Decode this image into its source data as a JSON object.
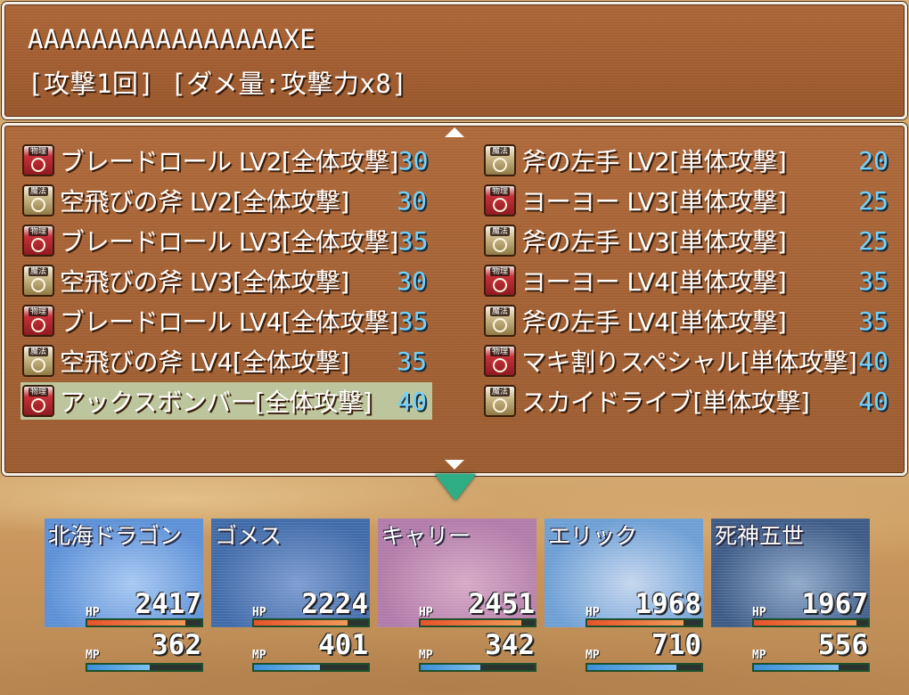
{
  "help": {
    "line1": "AAAAAAAAAAAAAAAAXE",
    "line2": "[攻撃1回] [ダメ量:攻撃力x8]"
  },
  "skills": [
    {
      "icon": "物理",
      "type": "phys",
      "name": "ブレードロール  LV2[全体攻撃]",
      "cost": "30"
    },
    {
      "icon": "魔法",
      "type": "magic",
      "name": "斧の左手  LV2[単体攻撃]",
      "cost": "20"
    },
    {
      "icon": "魔法",
      "type": "magic",
      "name": "空飛びの斧  LV2[全体攻撃]",
      "cost": "30"
    },
    {
      "icon": "物理",
      "type": "phys",
      "name": "ヨーヨー  LV3[単体攻撃]",
      "cost": "25"
    },
    {
      "icon": "物理",
      "type": "phys",
      "name": "ブレードロール  LV3[全体攻撃]",
      "cost": "35"
    },
    {
      "icon": "魔法",
      "type": "magic",
      "name": "斧の左手  LV3[単体攻撃]",
      "cost": "25"
    },
    {
      "icon": "魔法",
      "type": "magic",
      "name": "空飛びの斧  LV3[全体攻撃]",
      "cost": "30"
    },
    {
      "icon": "物理",
      "type": "phys",
      "name": "ヨーヨー  LV4[単体攻撃]",
      "cost": "35"
    },
    {
      "icon": "物理",
      "type": "phys",
      "name": "ブレードロール  LV4[全体攻撃]",
      "cost": "35"
    },
    {
      "icon": "魔法",
      "type": "magic",
      "name": "斧の左手  LV4[単体攻撃]",
      "cost": "35"
    },
    {
      "icon": "魔法",
      "type": "magic",
      "name": "空飛びの斧  LV4[全体攻撃]",
      "cost": "35"
    },
    {
      "icon": "物理",
      "type": "phys",
      "name": "マキ割りスペシャル[単体攻撃]",
      "cost": "40"
    },
    {
      "icon": "物理",
      "type": "phys",
      "name": "アックスボンバー[全体攻撃]",
      "cost": "40",
      "selected": true
    },
    {
      "icon": "魔法",
      "type": "magic",
      "name": "スカイドライブ[単体攻撃]",
      "cost": "40"
    }
  ],
  "party": [
    {
      "name": "北海ドラゴン",
      "hp_label": "HP",
      "hp": "2417",
      "hp_ratio": 0.86,
      "mp_label": "MP",
      "mp": "362",
      "mp_ratio": 0.55,
      "face_color": "#5b8fd6",
      "face_color2": "#a7c8f2"
    },
    {
      "name": "ゴメス",
      "hp_label": "HP",
      "hp": "2224",
      "hp_ratio": 0.82,
      "mp_label": "MP",
      "mp": "401",
      "mp_ratio": 0.58,
      "face_color": "#3f6aa8",
      "face_color2": "#7d9bd0"
    },
    {
      "name": "キャリー",
      "hp_label": "HP",
      "hp": "2451",
      "hp_ratio": 0.88,
      "mp_label": "MP",
      "mp": "342",
      "mp_ratio": 0.52,
      "face_color": "#b07aa8",
      "face_color2": "#d7a9c6"
    },
    {
      "name": "エリック",
      "hp_label": "HP",
      "hp": "1968",
      "hp_ratio": 0.84,
      "mp_label": "MP",
      "mp": "710",
      "mp_ratio": 0.78,
      "face_color": "#6c9ed4",
      "face_color2": "#c4d6ee"
    },
    {
      "name": "死神五世",
      "hp_label": "HP",
      "hp": "1967",
      "hp_ratio": 0.9,
      "mp_label": "MP",
      "mp": "556",
      "mp_ratio": 0.74,
      "face_color": "#3c5a86",
      "face_color2": "#8fa9c9"
    }
  ],
  "colors": {
    "hp_gauge": "#e8522b",
    "hp_gauge2": "#f19a5a",
    "mp_gauge": "#3a8fd8",
    "mp_gauge2": "#7cc0f0",
    "cost_text": "#6fd3ff"
  }
}
